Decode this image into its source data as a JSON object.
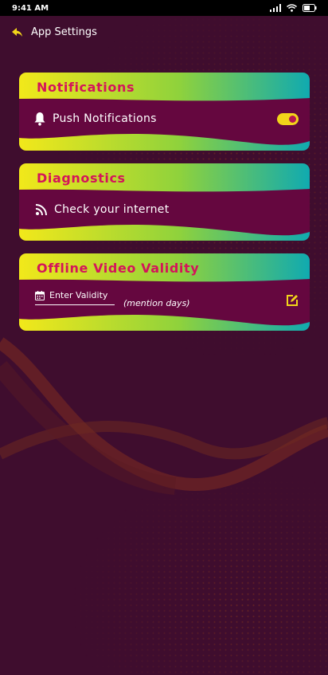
{
  "status_bar": {
    "time": "9:41 AM"
  },
  "header": {
    "back_icon": "back-arrow-icon",
    "title": "App Settings"
  },
  "cards": {
    "notifications": {
      "title": "Notifications",
      "items": [
        {
          "icon": "bell-icon",
          "label": "Push Notifications",
          "toggle_on": true
        }
      ]
    },
    "diagnostics": {
      "title": "Diagnostics",
      "items": [
        {
          "icon": "rss-icon",
          "label": "Check your internet"
        }
      ]
    },
    "offline": {
      "title": "Offline Video Validity",
      "input_placeholder": "Enter Validity",
      "hint": "(mention days)",
      "edit_icon": "edit-icon"
    }
  },
  "colors": {
    "background": "#3f0d2e",
    "card_body": "#65073f",
    "title": "#d4145a",
    "accent_yellow": "#f2d51a",
    "accent_teal": "#10aab0",
    "accent_green": "#8fd23c"
  }
}
